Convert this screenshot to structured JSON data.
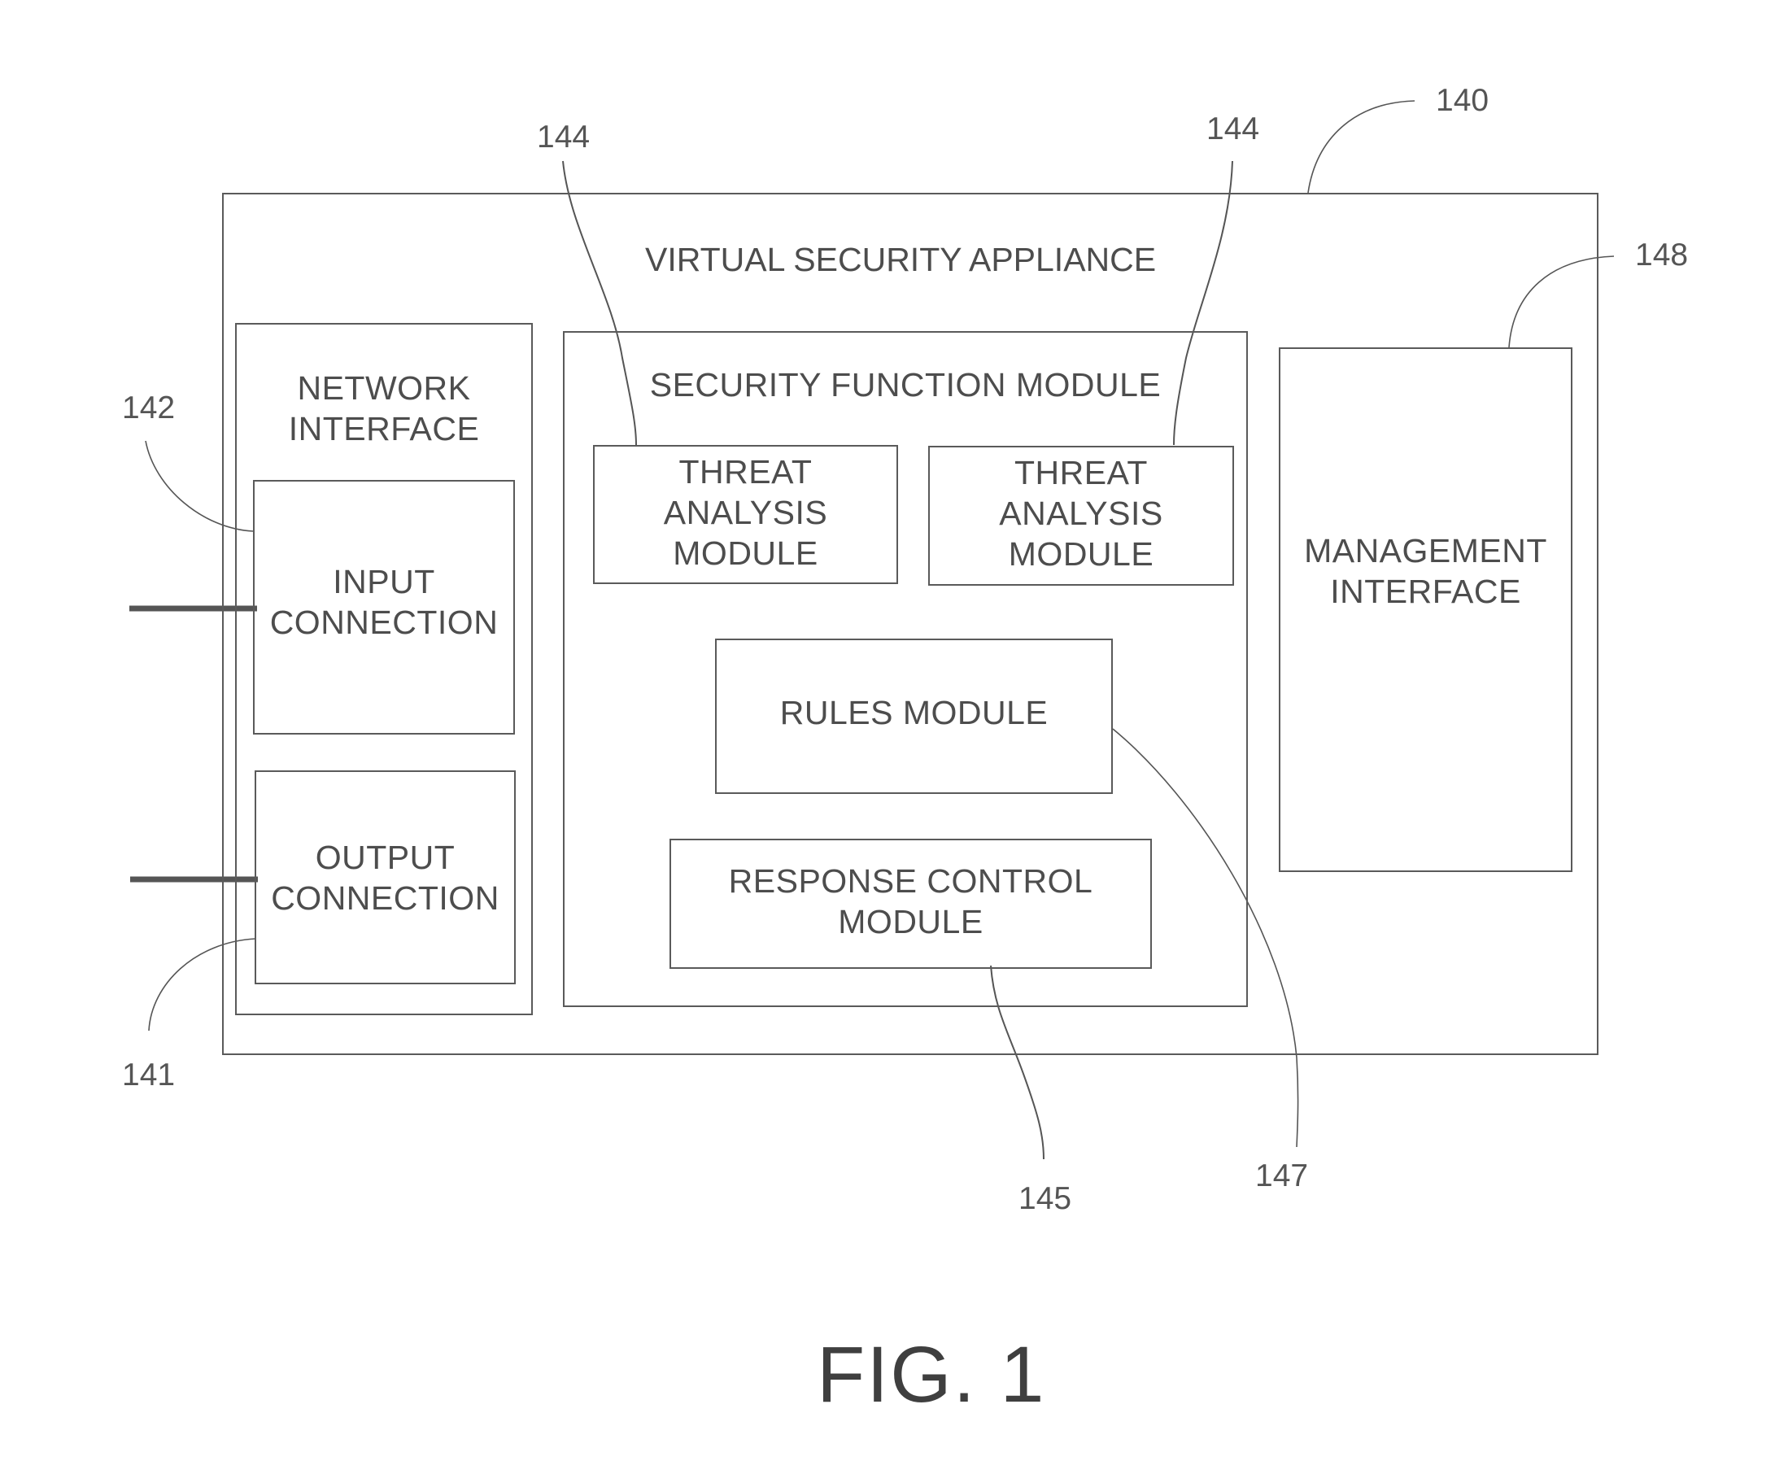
{
  "figure": {
    "caption": "FIG. 1",
    "colors": {
      "line": "#5a5a5a",
      "text": "#4d4d4d",
      "connection": "#555555"
    }
  },
  "appliance": {
    "title": "VIRTUAL SECURITY APPLIANCE",
    "ref": "140"
  },
  "network_interface": {
    "title": "NETWORK\nINTERFACE",
    "input_connection": {
      "label": "INPUT\nCONNECTION",
      "ref": "142"
    },
    "output_connection": {
      "label": "OUTPUT\nCONNECTION",
      "ref": "141"
    }
  },
  "security_function_module": {
    "title": "SECURITY FUNCTION MODULE",
    "threat_analysis_modules": [
      {
        "label": "THREAT\nANALYSIS\nMODULE",
        "ref": "144"
      },
      {
        "label": "THREAT\nANALYSIS\nMODULE",
        "ref": "144"
      }
    ],
    "rules_module": {
      "label": "RULES MODULE",
      "ref": "147"
    },
    "response_control_module": {
      "label": "RESPONSE CONTROL\nMODULE",
      "ref": "145"
    }
  },
  "management_interface": {
    "label": "MANAGEMENT\nINTERFACE",
    "ref": "148"
  }
}
